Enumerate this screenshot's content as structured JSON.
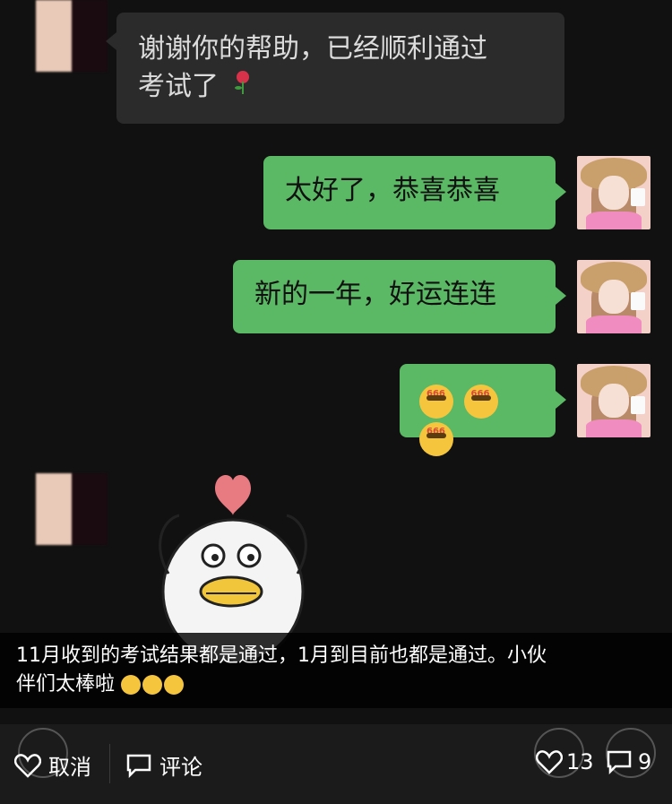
{
  "chat": {
    "messages": [
      {
        "side": "left",
        "text_line1": "谢谢你的帮助，已经顺利通过",
        "text_line2": "考试了",
        "icon": "rose-icon"
      },
      {
        "side": "right",
        "text": "太好了，恭喜恭喜"
      },
      {
        "side": "right",
        "text": "新的一年，好运连连"
      },
      {
        "side": "right",
        "emoji_count": 3,
        "emoji": "666-emoji",
        "badge": "666"
      }
    ]
  },
  "caption": {
    "line1": "11月收到的考试结果都是通过，1月到目前也都是通过。小伙",
    "line2": "伴们太棒啦",
    "emoji_count": 3
  },
  "toolbar": {
    "cancel_label": "取消",
    "comment_label": "评论",
    "likes": "13",
    "comments": "9"
  },
  "colors": {
    "background": "#111111",
    "bubble_left": "#2b2b2b",
    "bubble_right": "#5bb864",
    "toolbar": "#1b1b1b"
  }
}
